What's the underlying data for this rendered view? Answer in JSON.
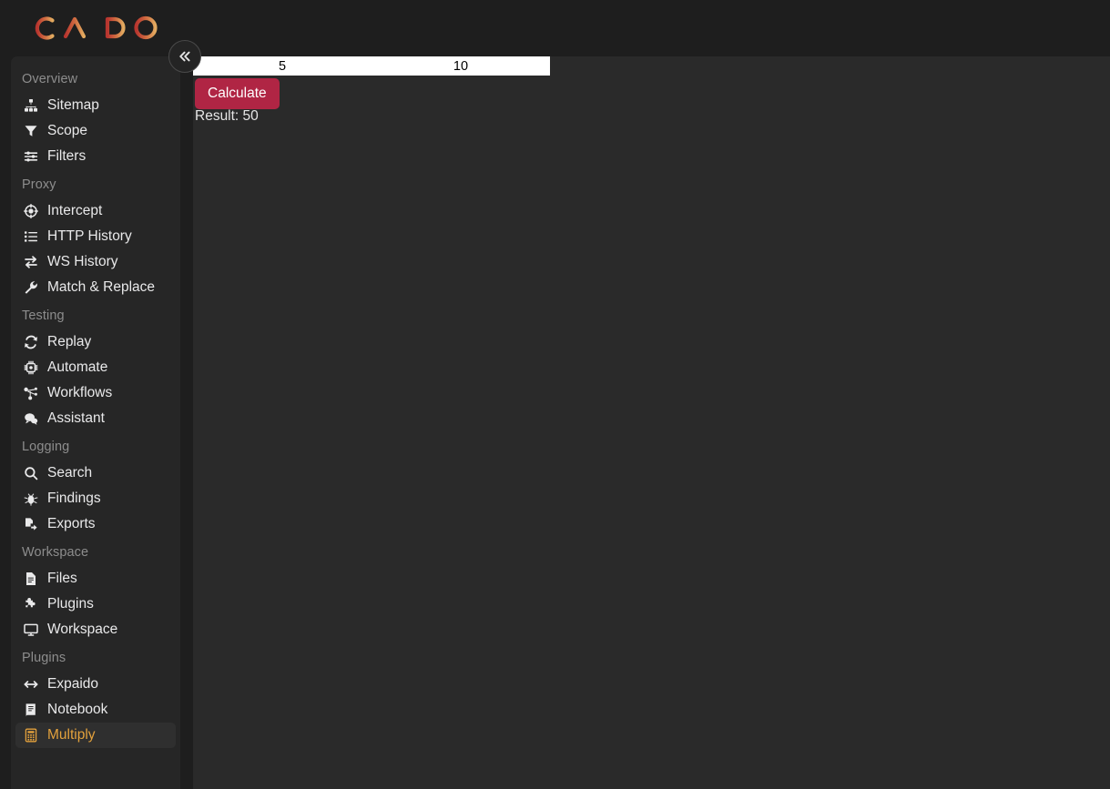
{
  "app": {
    "brand": "CAIDO",
    "brand_colors": {
      "start": "#b8352f",
      "mid": "#cf6a40",
      "end": "#e3ab60"
    },
    "background": "#1e1e1e",
    "sidebar_background": "#262626",
    "content_background": "#2a2a2a",
    "accent": "#e3a13c"
  },
  "collapse_button": {
    "label": "«",
    "name": "collapse-sidebar"
  },
  "sidebar": {
    "groups": [
      {
        "label": "Overview",
        "items": [
          {
            "label": "Sitemap",
            "icon": "sitemap-icon",
            "active": false
          },
          {
            "label": "Scope",
            "icon": "funnel-icon",
            "active": false
          },
          {
            "label": "Filters",
            "icon": "sliders-icon",
            "active": false
          }
        ]
      },
      {
        "label": "Proxy",
        "items": [
          {
            "label": "Intercept",
            "icon": "crosshair-icon",
            "active": false
          },
          {
            "label": "HTTP History",
            "icon": "list-icon",
            "active": false
          },
          {
            "label": "WS History",
            "icon": "exchange-icon",
            "active": false
          },
          {
            "label": "Match & Replace",
            "icon": "wrench-icon",
            "active": false
          }
        ]
      },
      {
        "label": "Testing",
        "items": [
          {
            "label": "Replay",
            "icon": "refresh-icon",
            "active": false
          },
          {
            "label": "Automate",
            "icon": "chip-icon",
            "active": false
          },
          {
            "label": "Workflows",
            "icon": "workflow-icon",
            "active": false
          },
          {
            "label": "Assistant",
            "icon": "chat-icon",
            "active": false
          }
        ]
      },
      {
        "label": "Logging",
        "items": [
          {
            "label": "Search",
            "icon": "search-icon",
            "active": false
          },
          {
            "label": "Findings",
            "icon": "bug-icon",
            "active": false
          },
          {
            "label": "Exports",
            "icon": "export-icon",
            "active": false
          }
        ]
      },
      {
        "label": "Workspace",
        "items": [
          {
            "label": "Files",
            "icon": "file-icon",
            "active": false
          },
          {
            "label": "Plugins",
            "icon": "puzzle-icon",
            "active": false
          },
          {
            "label": "Workspace",
            "icon": "monitor-icon",
            "active": false
          }
        ]
      },
      {
        "label": "Plugins",
        "items": [
          {
            "label": "Expaido",
            "icon": "arrows-lr-icon",
            "active": false
          },
          {
            "label": "Notebook",
            "icon": "book-icon",
            "active": false
          },
          {
            "label": "Multiply",
            "icon": "calculator-icon",
            "active": true
          }
        ]
      }
    ]
  },
  "main": {
    "plugin": "Multiply",
    "inputs": [
      {
        "name": "first-number",
        "value": "5",
        "placeholder": ""
      },
      {
        "name": "second-number",
        "value": "10",
        "placeholder": ""
      }
    ],
    "calculate_label": "Calculate",
    "calculate_color": "#b02544",
    "result_text": "Result: 50"
  }
}
